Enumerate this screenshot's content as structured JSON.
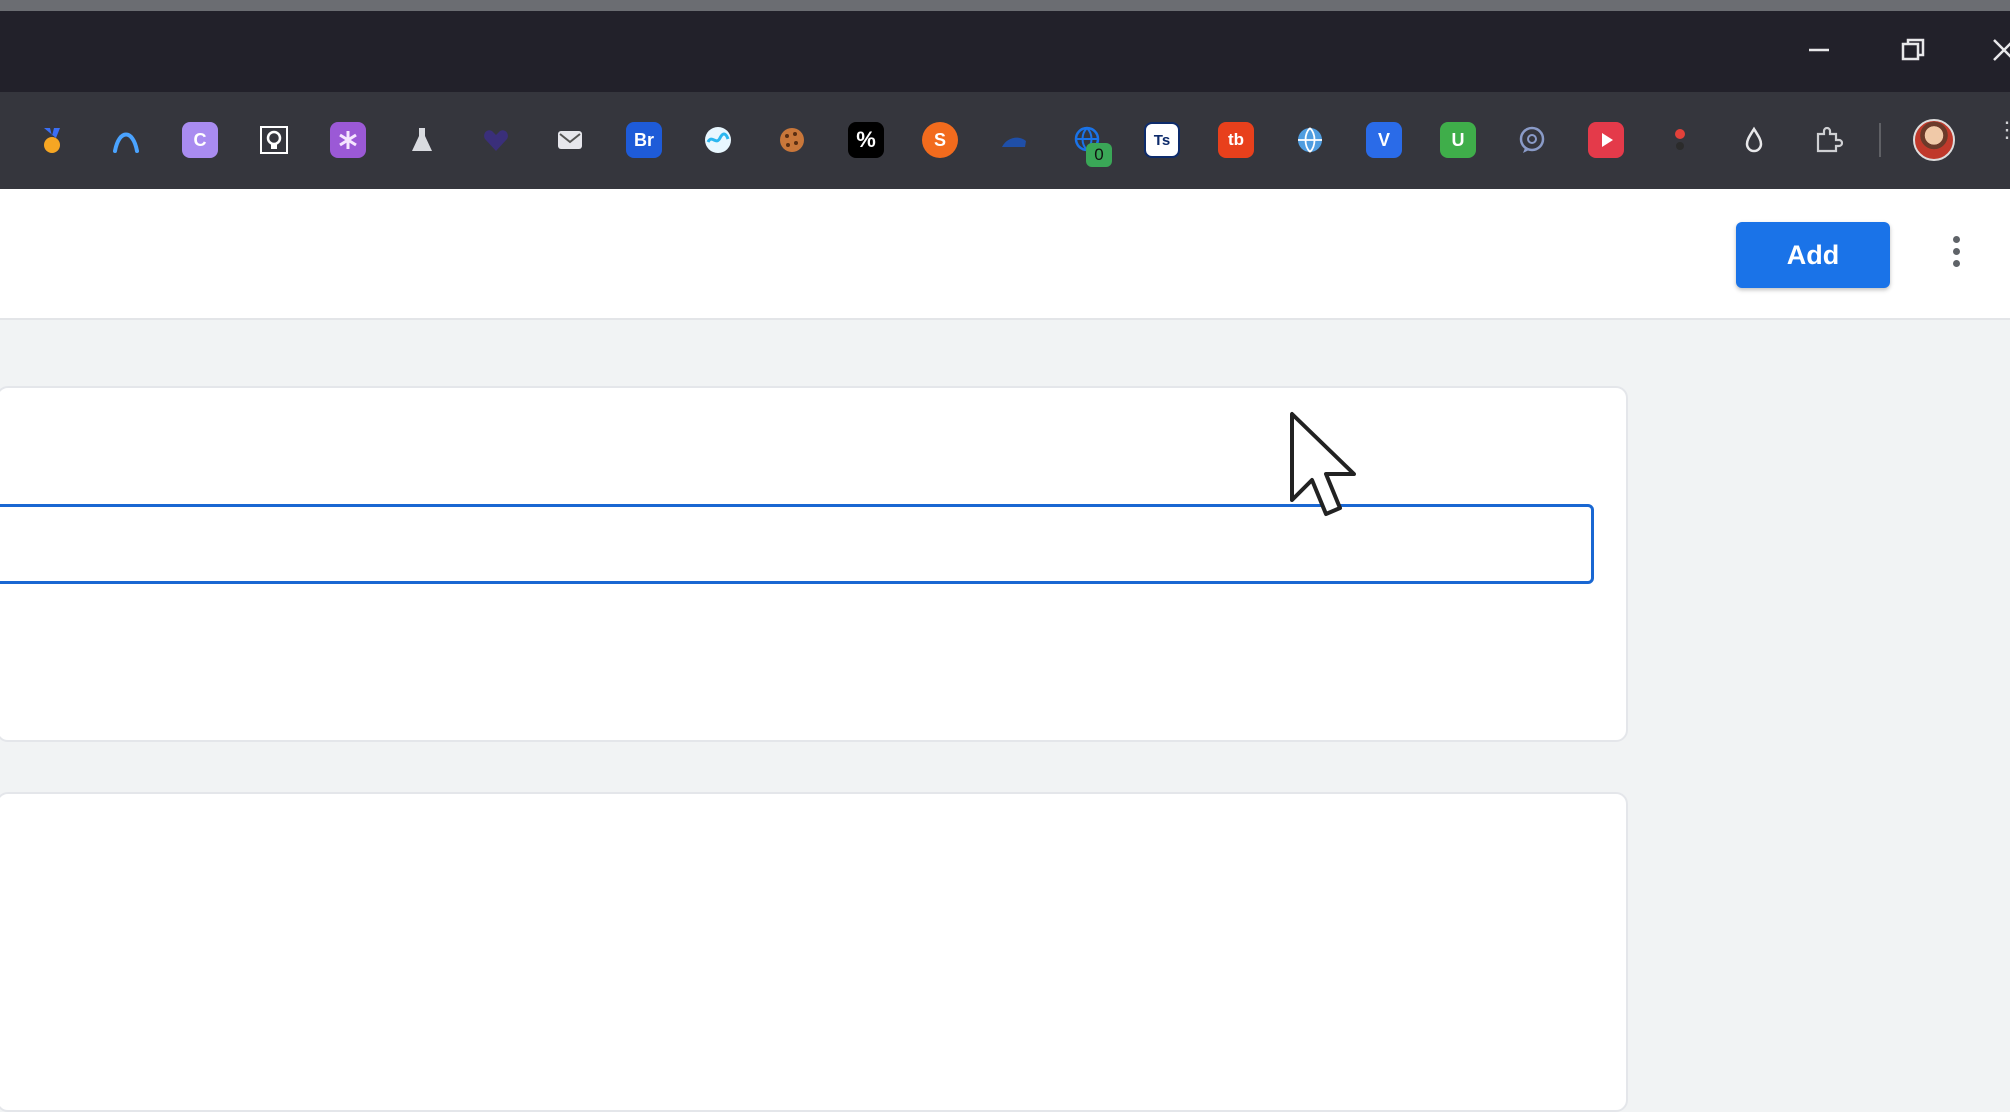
{
  "window": {
    "controls": [
      "minimize-icon",
      "restore-icon",
      "close-icon"
    ]
  },
  "toolbar": {
    "extensions": [
      {
        "name": "medal-extension-icon",
        "color": "#f6a623"
      },
      {
        "name": "arc-extension-icon",
        "color": "#4aa3ff"
      },
      {
        "name": "c-extension-icon",
        "label": "C",
        "color": "#a98cf0"
      },
      {
        "name": "lightbulb-extension-icon",
        "color": "#ffffff"
      },
      {
        "name": "asterisk-extension-icon",
        "color": "#9b59d6"
      },
      {
        "name": "flask-extension-icon",
        "color": "#d9dbe0"
      },
      {
        "name": "heart-extension-icon",
        "color": "#3a2f7a"
      },
      {
        "name": "envelope-extension-icon",
        "color": "#e6e6ec"
      },
      {
        "name": "bridge-extension-icon",
        "label": "Br",
        "color": "#1e5bd8"
      },
      {
        "name": "wave-extension-icon",
        "color": "#2bb7f0"
      },
      {
        "name": "cookie-extension-icon",
        "color": "#c9773a"
      },
      {
        "name": "percent-extension-icon",
        "label": "%",
        "color": "#000000"
      },
      {
        "name": "s-extension-icon",
        "label": "S",
        "color": "#f26b1d"
      },
      {
        "name": "hat-extension-icon",
        "color": "#1f4fa8"
      },
      {
        "name": "globe-badge-extension-icon",
        "color": "#1a73e8"
      },
      {
        "name": "ts-extension-icon",
        "label": "Ts",
        "color": "#0d2b6b"
      },
      {
        "name": "tb-extension-icon",
        "label": "tb",
        "color": "#e8401c"
      },
      {
        "name": "world-extension-icon",
        "color": "#4f9de0"
      },
      {
        "name": "v-extension-icon",
        "label": "V",
        "color": "#2a6be8"
      },
      {
        "name": "u-extension-icon",
        "label": "U",
        "color": "#3fae4a"
      },
      {
        "name": "chat-extension-icon",
        "color": "#8a9bc8"
      },
      {
        "name": "play-extension-icon",
        "color": "#e43a4a"
      },
      {
        "name": "traffic-extension-icon",
        "color": "#e2413a"
      },
      {
        "name": "drop-extension-icon",
        "color": "#e8e8ea"
      },
      {
        "name": "puzzle-extension-icon",
        "color": "#cfd0d3"
      }
    ],
    "badge_count": "0"
  },
  "header": {
    "add_label": "Add"
  },
  "form": {
    "field_value": ""
  }
}
